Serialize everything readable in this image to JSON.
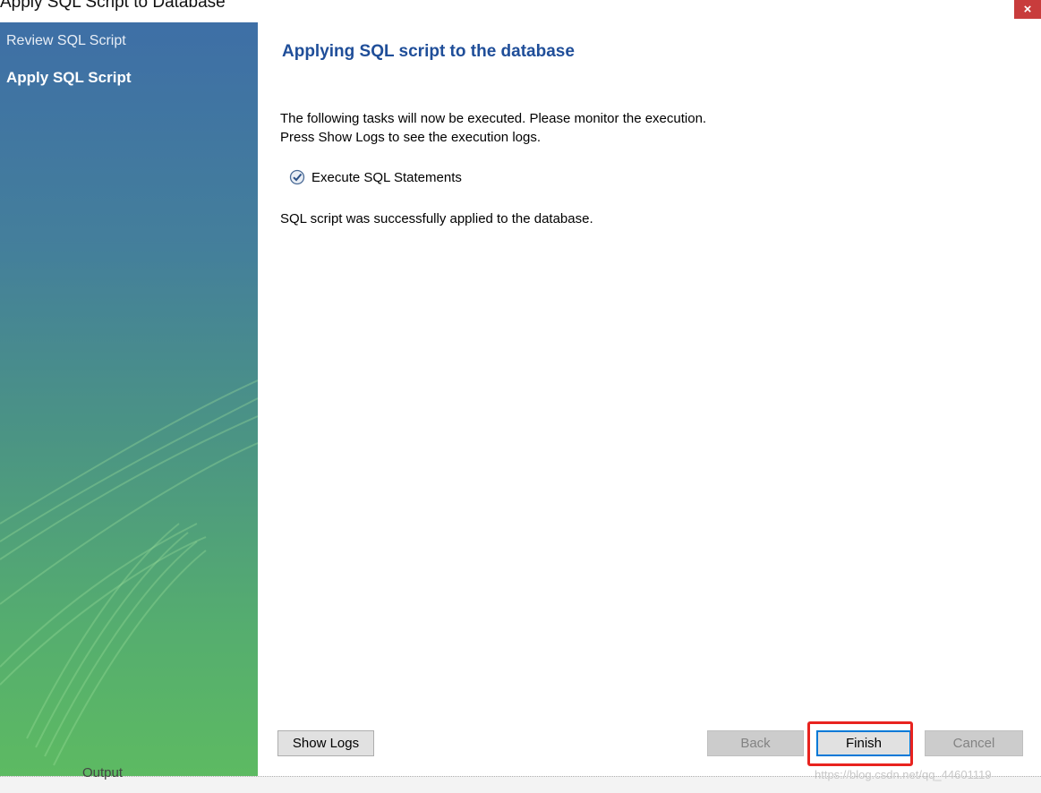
{
  "window": {
    "title": "Apply SQL Script to Database",
    "close_label": "×"
  },
  "sidebar": {
    "items": [
      {
        "label": "Review SQL Script",
        "active": false
      },
      {
        "label": "Apply SQL Script",
        "active": true
      }
    ]
  },
  "main": {
    "heading": "Applying SQL script to the database",
    "description_line1": "The following tasks will now be executed. Please monitor the execution.",
    "description_line2": "Press Show Logs to see the execution logs.",
    "task": {
      "label": "Execute SQL Statements",
      "status_icon": "check-circle-icon"
    },
    "status_message": "SQL script was successfully applied to the database."
  },
  "buttons": {
    "show_logs": "Show Logs",
    "back": "Back",
    "finish": "Finish",
    "cancel": "Cancel"
  },
  "background": {
    "output_label": "Output",
    "watermark": "https://blog.csdn.net/qq_44601119"
  },
  "colors": {
    "heading": "#1f4e99",
    "highlight": "#e8231f",
    "close": "#c83c3c"
  }
}
